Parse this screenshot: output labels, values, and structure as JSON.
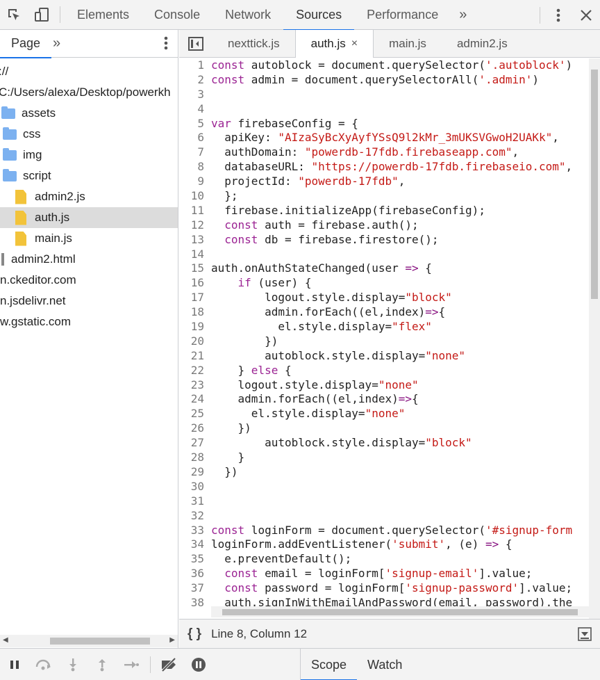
{
  "toolbar": {
    "tabs": [
      "Elements",
      "Console",
      "Network",
      "Sources",
      "Performance"
    ],
    "active_tab": "Sources",
    "more_glyph": "»"
  },
  "navigator": {
    "tab": "Page",
    "more_glyph": "»",
    "tree": [
      {
        "label": "://",
        "kind": "text",
        "indent": 0
      },
      {
        "label": "C:/Users/alexa/Desktop/powerkh",
        "kind": "text",
        "indent": 0
      },
      {
        "label": "assets",
        "kind": "folder",
        "indent": 0
      },
      {
        "label": "css",
        "kind": "folder",
        "indent": 1
      },
      {
        "label": "img",
        "kind": "folder",
        "indent": 1
      },
      {
        "label": "script",
        "kind": "folder",
        "indent": 1
      },
      {
        "label": "admin2.js",
        "kind": "js",
        "indent": 2
      },
      {
        "label": "auth.js",
        "kind": "js",
        "indent": 2,
        "selected": true
      },
      {
        "label": "main.js",
        "kind": "js",
        "indent": 2
      },
      {
        "label": "admin2.html",
        "kind": "html",
        "indent": 0
      },
      {
        "label": "n.ckeditor.com",
        "kind": "text",
        "indent": 0
      },
      {
        "label": "n.jsdelivr.net",
        "kind": "text",
        "indent": 0
      },
      {
        "label": "w.gstatic.com",
        "kind": "text",
        "indent": 0
      }
    ]
  },
  "editor": {
    "tabs": [
      {
        "label": "nexttick.js",
        "active": false
      },
      {
        "label": "auth.js",
        "active": true
      },
      {
        "label": "main.js",
        "active": false
      },
      {
        "label": "admin2.js",
        "active": false
      }
    ],
    "close_glyph": "×",
    "lines": [
      "const autoblock = document.querySelector('.autoblock')",
      "const admin = document.querySelectorAll('.admin')",
      "",
      "",
      "var firebaseConfig = {",
      "  apiKey: \"AIzaSyBcXyAyfYSsQ9l2kMr_3mUKSVGwoH2UAKk\",",
      "  authDomain: \"powerdb-17fdb.firebaseapp.com\",",
      "  databaseURL: \"https://powerdb-17fdb.firebaseio.com\",",
      "  projectId: \"powerdb-17fdb\",",
      "  };",
      "  firebase.initializeApp(firebaseConfig);",
      "  const auth = firebase.auth();",
      "  const db = firebase.firestore();",
      "",
      "auth.onAuthStateChanged(user => {",
      "    if (user) {",
      "        logout.style.display=\"block\"",
      "        admin.forEach((el,index)=>{",
      "          el.style.display=\"flex\"",
      "        })",
      "        autoblock.style.display=\"none\"",
      "    } else {",
      "    logout.style.display=\"none\"",
      "    admin.forEach((el,index)=>{",
      "      el.style.display=\"none\"",
      "    })",
      "        autoblock.style.display=\"block\"",
      "    }",
      "  })",
      "",
      "",
      "",
      "const loginForm = document.querySelector('#signup-form",
      "loginForm.addEventListener('submit', (e) => {",
      "  e.preventDefault();",
      "  const email = loginForm['signup-email'].value;",
      "  const password = loginForm['signup-password'].value;",
      "  auth.signInWithEmailAndPassword(email, password).the"
    ]
  },
  "status": {
    "braces": "{ }",
    "position": "Line 8, Column 12"
  },
  "debugger": {
    "tabs": [
      "Scope",
      "Watch"
    ],
    "active_tab": "Scope"
  }
}
